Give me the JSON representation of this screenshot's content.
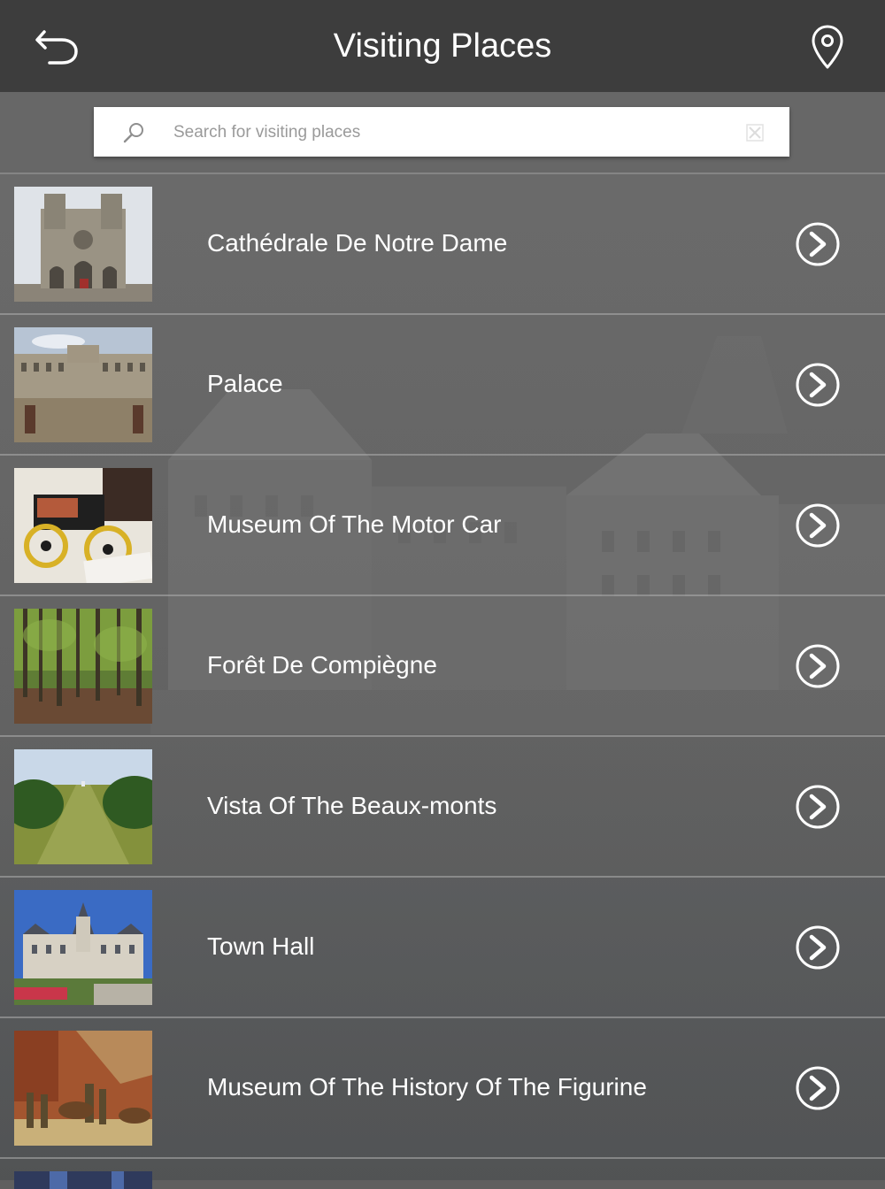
{
  "header": {
    "title": "Visiting Places",
    "back_icon": "back-arrow-icon",
    "map_icon": "location-pin-icon"
  },
  "search": {
    "placeholder": "Search for visiting places",
    "value": ""
  },
  "places": [
    {
      "name": "Cathédrale De Notre Dame",
      "thumb": "cathedral"
    },
    {
      "name": "Palace",
      "thumb": "palace"
    },
    {
      "name": "Museum Of The Motor Car",
      "thumb": "motor-car"
    },
    {
      "name": "Forêt De Compiègne",
      "thumb": "forest"
    },
    {
      "name": "Vista Of The Beaux-monts",
      "thumb": "vista"
    },
    {
      "name": "Town Hall",
      "thumb": "town-hall"
    },
    {
      "name": "Museum Of The History Of The Figurine",
      "thumb": "figurine"
    }
  ],
  "colors": {
    "header_bg": "#3d3d3d",
    "text": "#ffffff",
    "placeholder": "#9a9a9a"
  }
}
